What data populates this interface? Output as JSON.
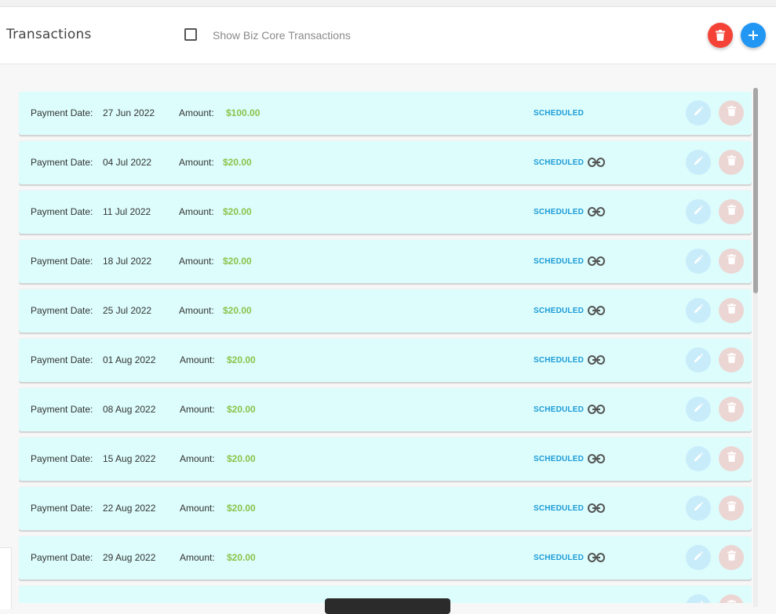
{
  "header": {
    "title": "Transactions",
    "show_biz_core_label": "Show Biz Core Transactions",
    "show_biz_core_checked": false,
    "delete_icon": "trash-icon",
    "add_icon": "plus-icon"
  },
  "labels": {
    "payment_date": "Payment Date:",
    "amount": "Amount:"
  },
  "transactions": [
    {
      "date": "27 Jun 2022",
      "amount": "$100.00",
      "status": "SCHEDULED",
      "linked": false
    },
    {
      "date": "04 Jul 2022",
      "amount": "$20.00",
      "status": "SCHEDULED",
      "linked": true
    },
    {
      "date": "11 Jul 2022",
      "amount": "$20.00",
      "status": "SCHEDULED",
      "linked": true
    },
    {
      "date": "18 Jul 2022",
      "amount": "$20.00",
      "status": "SCHEDULED",
      "linked": true
    },
    {
      "date": "25 Jul 2022",
      "amount": "$20.00",
      "status": "SCHEDULED",
      "linked": true
    },
    {
      "date": "01 Aug 2022",
      "amount": "$20.00",
      "status": "SCHEDULED",
      "linked": true
    },
    {
      "date": "08 Aug 2022",
      "amount": "$20.00",
      "status": "SCHEDULED",
      "linked": true
    },
    {
      "date": "15 Aug 2022",
      "amount": "$20.00",
      "status": "SCHEDULED",
      "linked": true
    },
    {
      "date": "22 Aug 2022",
      "amount": "$20.00",
      "status": "SCHEDULED",
      "linked": true
    },
    {
      "date": "29 Aug 2022",
      "amount": "$20.00",
      "status": "SCHEDULED",
      "linked": true
    },
    {
      "date": "",
      "amount": "",
      "status": "",
      "linked": false
    }
  ],
  "colors": {
    "row_background": "#dcfdfc",
    "amount": "#8bc34a",
    "status": "#1e9bd7",
    "delete_button": "#f44336",
    "add_button": "#2196f3"
  }
}
